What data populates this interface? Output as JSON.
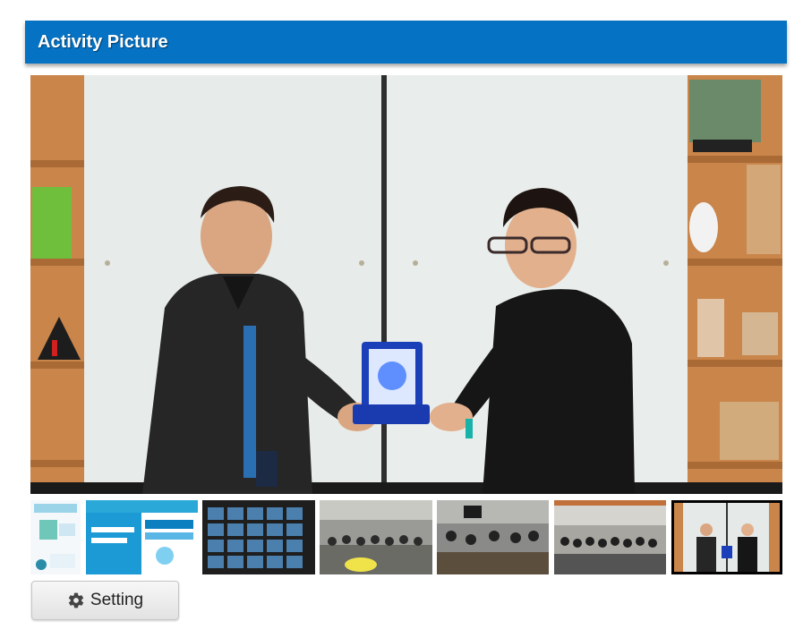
{
  "header": {
    "title": "Activity Picture"
  },
  "gallery": {
    "main_image_icon": "photo-two-men-exchanging-award",
    "thumbnails": [
      {
        "icon": "poster-thumbnail",
        "active": false
      },
      {
        "icon": "webinar-poster-thumbnail",
        "active": false
      },
      {
        "icon": "video-call-grid-thumbnail",
        "active": false
      },
      {
        "icon": "group-photo-thumbnail",
        "active": false
      },
      {
        "icon": "meeting-room-thumbnail",
        "active": false
      },
      {
        "icon": "office-group-thumbnail",
        "active": false
      },
      {
        "icon": "award-exchange-thumbnail",
        "active": true
      }
    ]
  },
  "setting_button": {
    "label": "Setting",
    "icon": "gear-icon"
  },
  "colors": {
    "header": "#0572c4",
    "header_text": "#ffffff",
    "active_border": "#000000"
  }
}
